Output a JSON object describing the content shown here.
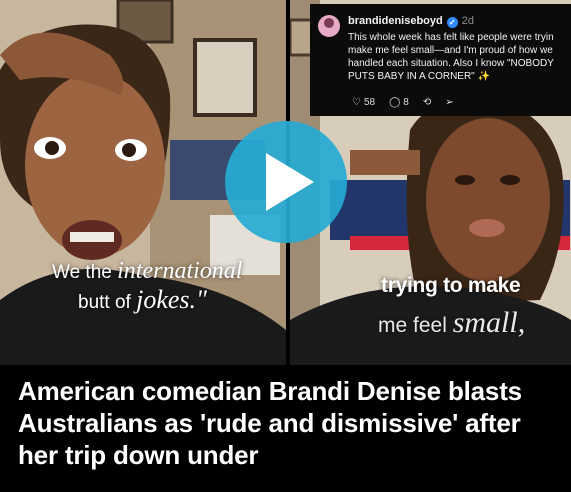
{
  "captions": {
    "left": {
      "line1_a": "We the ",
      "line1_b": "international",
      "line2_a": "butt of ",
      "line2_b": "jokes.\""
    },
    "right": {
      "line1": "trying to make",
      "line2_a": "me feel ",
      "line2_b": "small,"
    }
  },
  "post": {
    "username": "brandideniseboyd",
    "time": "2d",
    "text": "This whole week has felt like people were tryin\nmake me feel small—and I'm proud of how we\nhandled each situation. Also I know \"NOBODY\nPUTS BABY IN A CORNER\" ✨",
    "likes": "58",
    "comments": "8"
  },
  "player": {
    "accent": "#26aad4"
  },
  "headline": "American comedian Brandi Denise blasts Australians as 'rude and dismissive' after her trip down under",
  "icons": [
    "play-icon",
    "verified-badge-icon",
    "heart-icon",
    "comment-icon",
    "repost-icon",
    "share-icon"
  ]
}
